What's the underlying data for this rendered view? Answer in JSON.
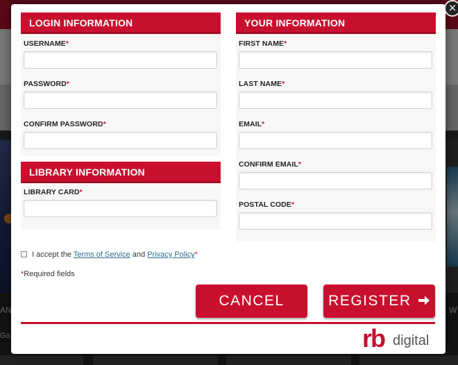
{
  "background": {
    "left_strip_text": "AN",
    "left_small_text": "Ga",
    "right_strip_text": "W"
  },
  "modal": {
    "close_glyph": "×",
    "login": {
      "header": "LOGIN INFORMATION",
      "username_label": "USERNAME",
      "password_label": "PASSWORD",
      "confirm_password_label": "CONFIRM PASSWORD",
      "username_value": "",
      "password_value": "",
      "confirm_password_value": ""
    },
    "library": {
      "header": "LIBRARY INFORMATION",
      "card_label": "LIBRARY CARD",
      "card_value": ""
    },
    "your_info": {
      "header": "YOUR INFORMATION",
      "first_name_label": "FIRST NAME",
      "last_name_label": "LAST NAME",
      "email_label": "EMAIL",
      "confirm_email_label": "CONFIRM EMAIL",
      "postal_code_label": "POSTAL CODE",
      "first_name_value": "",
      "last_name_value": "",
      "email_value": "",
      "confirm_email_value": "",
      "postal_code_value": ""
    },
    "required_marker": "*",
    "terms": {
      "prefix": "I accept the",
      "terms_link": "Terms of Service",
      "and": "and",
      "privacy_link": "Privacy Policy",
      "checked": false
    },
    "required_note": "Required fields",
    "cancel_label": "CANCEL",
    "register_label": "REGISTER",
    "register_icon": "arrow-right-icon",
    "logo": {
      "rb": "rb",
      "digital": "digital"
    }
  },
  "colors": {
    "brand_red": "#c8102e",
    "link": "#2a6e8a"
  }
}
